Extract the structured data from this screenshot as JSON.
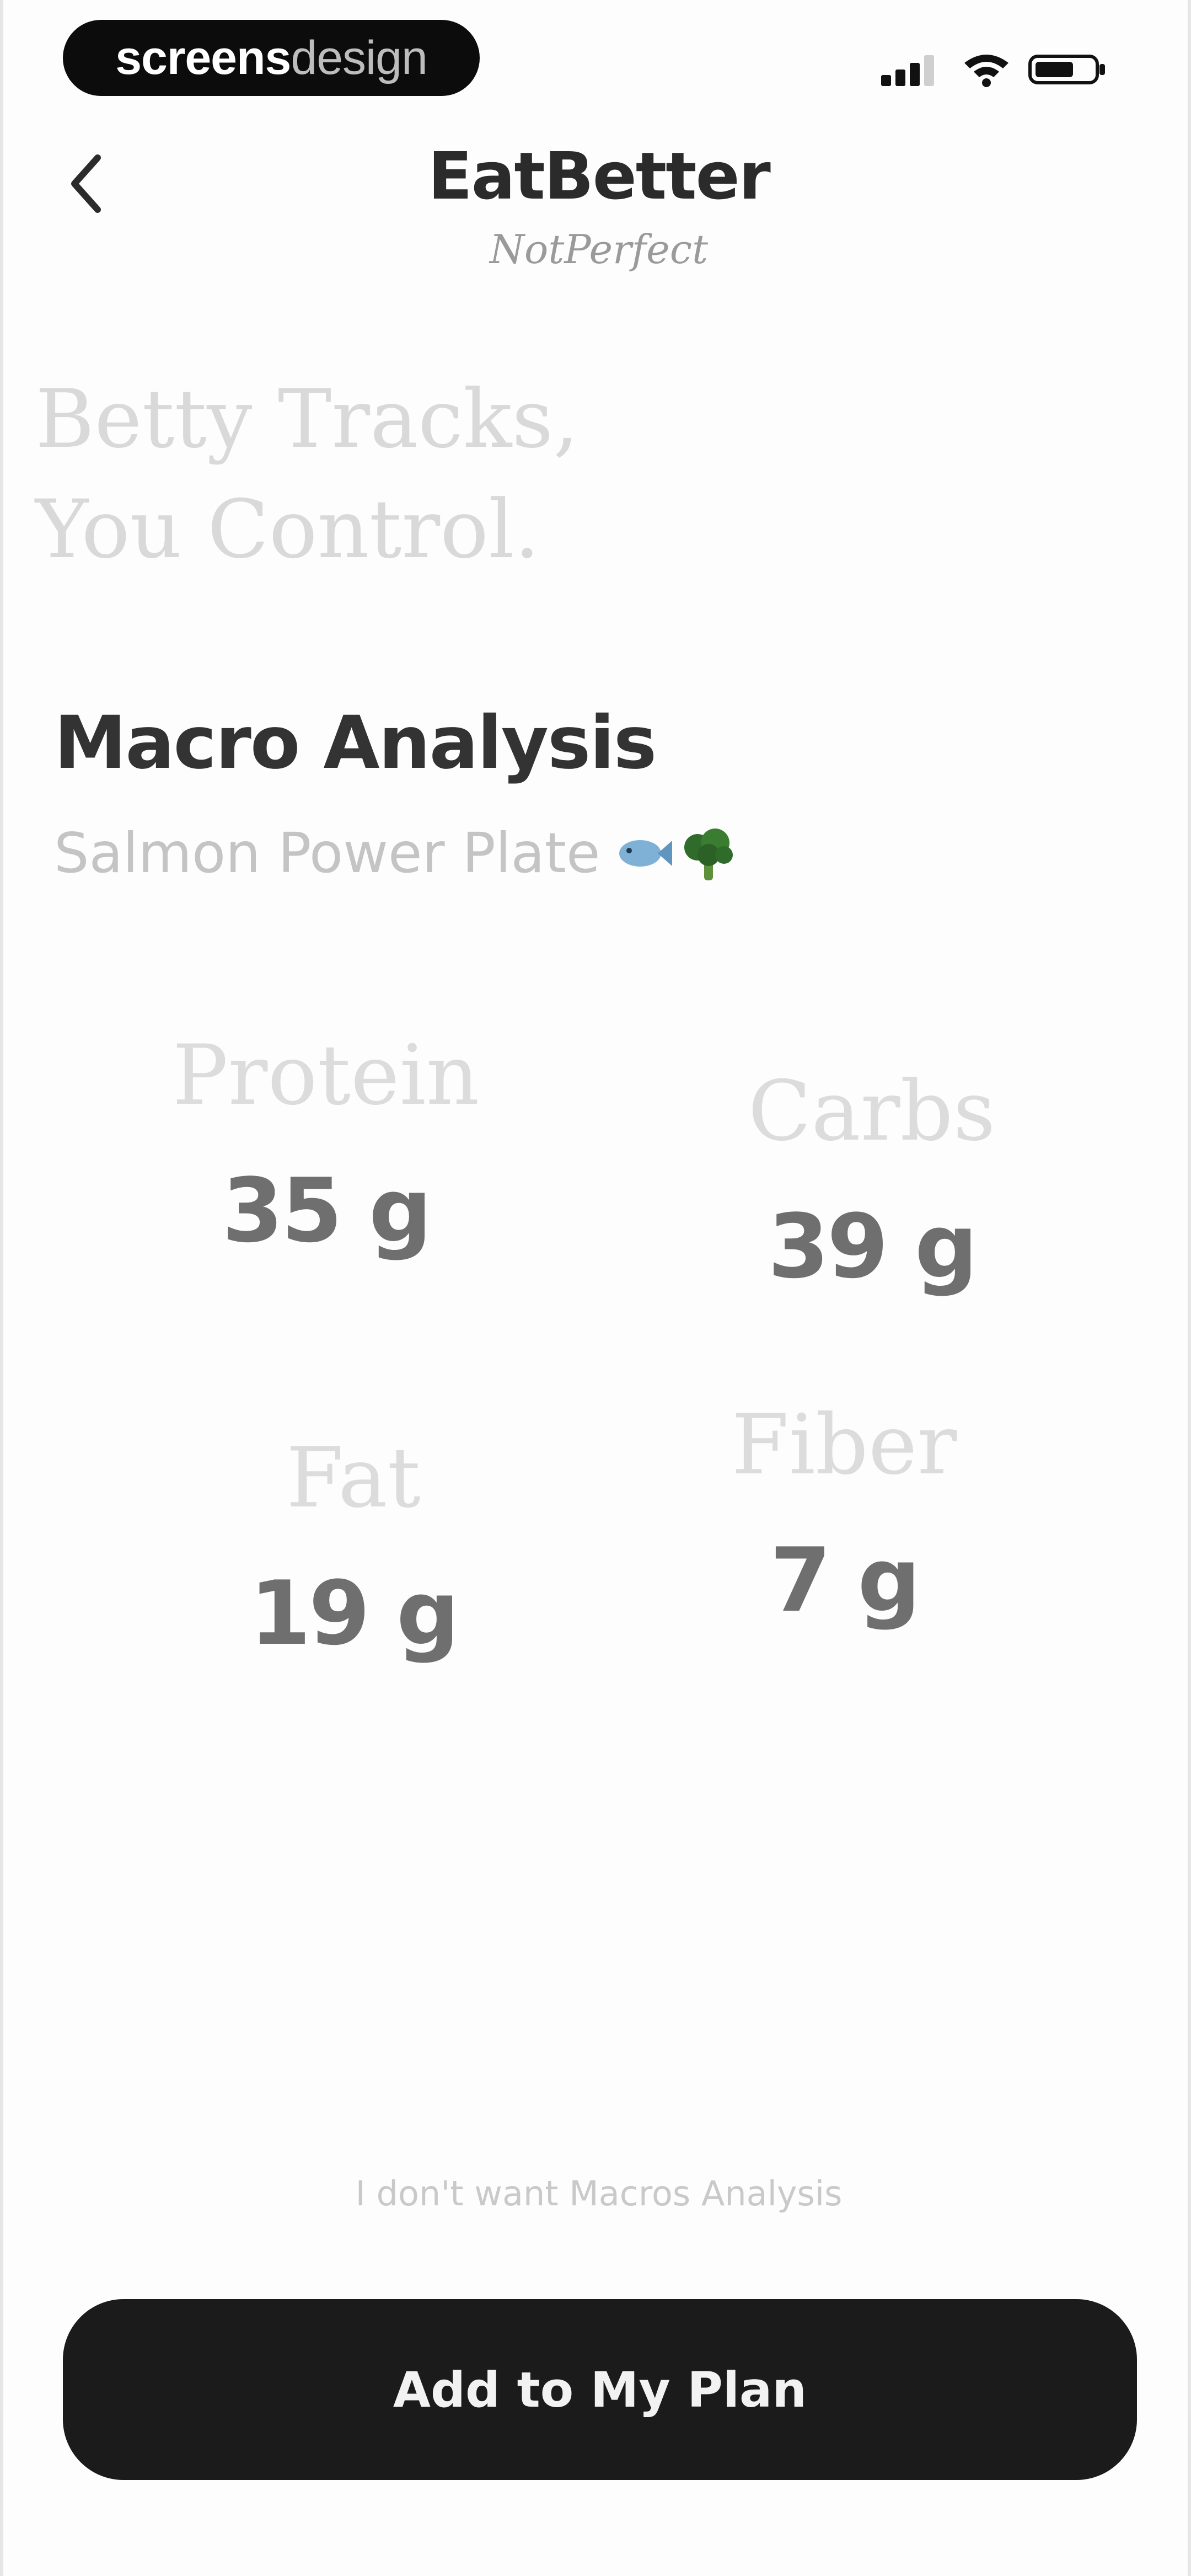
{
  "status_bar": {
    "brand_strong": "screens",
    "brand_light": "design",
    "signal_icon": "signal-bars-icon",
    "wifi_icon": "wifi-icon",
    "battery_icon": "battery-icon"
  },
  "header": {
    "back_icon": "chevron-left-icon",
    "title": "EatBetter",
    "subtitle": "NotPerfect"
  },
  "tagline": {
    "line1": "Betty Tracks,",
    "line2": "You Control."
  },
  "section": {
    "title": "Macro Analysis",
    "meal_name": "Salmon Power Plate",
    "meal_emoji": "🐟🥦"
  },
  "macros": {
    "protein": {
      "label": "Protein",
      "value": "35 g"
    },
    "carbs": {
      "label": "Carbs",
      "value": "39 g"
    },
    "fat": {
      "label": "Fat",
      "value": "19 g"
    },
    "fiber": {
      "label": "Fiber",
      "value": "7 g"
    }
  },
  "footer": {
    "skip_link": "I don't want Macros Analysis",
    "cta_label": "Add to My Plan"
  },
  "colors": {
    "button_bg": "#1b1b1b",
    "title_text": "#2b2b2b",
    "muted_text": "#c4c4c4",
    "macro_value": "#6f6f6f"
  }
}
